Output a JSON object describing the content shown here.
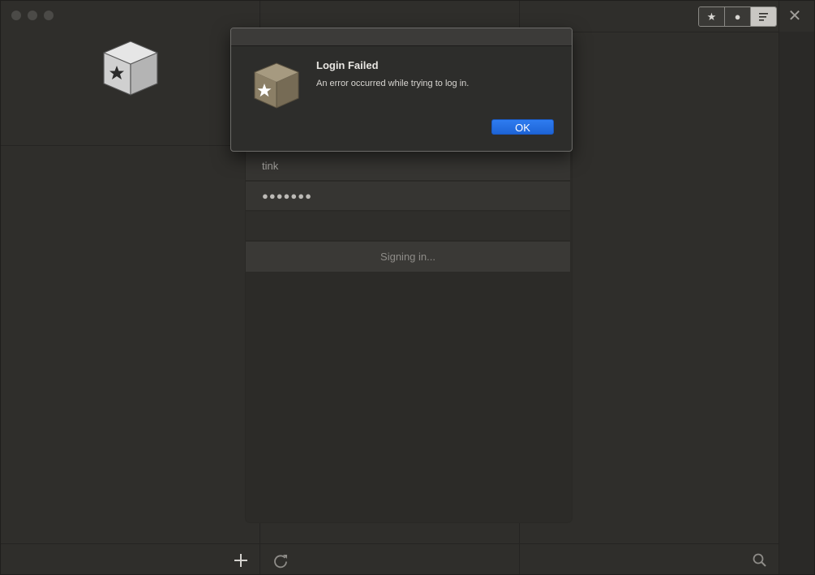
{
  "window": {
    "traffic_lights": [
      "close",
      "minimize",
      "zoom"
    ]
  },
  "toolbar": {
    "segments": [
      {
        "icon": "star-icon",
        "glyph": "★"
      },
      {
        "icon": "circle-icon",
        "glyph": "●"
      },
      {
        "icon": "list-icon",
        "glyph": "≡"
      }
    ],
    "close_glyph": "✕"
  },
  "login": {
    "username": "tink",
    "password_mask": "●●●●●●●",
    "status": "Signing in..."
  },
  "dialog": {
    "title": "Login Failed",
    "message": "An error occurred while trying to log in.",
    "ok_label": "OK"
  },
  "bottom_bar": {
    "add_icon": "plus-icon",
    "refresh_icon": "refresh-icon",
    "search_icon": "search-icon"
  },
  "colors": {
    "background": "#2f2e2b",
    "accent_button": "#1e64d6"
  }
}
